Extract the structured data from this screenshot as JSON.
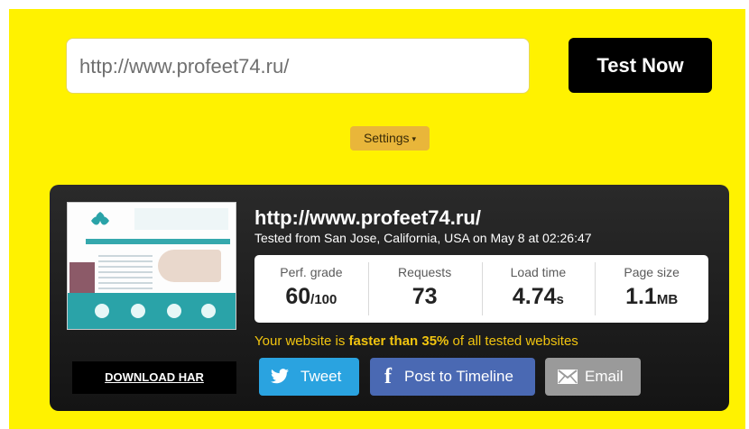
{
  "search": {
    "value": "http://www.profeet74.ru/",
    "button_label": "Test Now"
  },
  "settings": {
    "label": "Settings",
    "caret": "▾"
  },
  "result": {
    "url": "http://www.profeet74.ru/",
    "tested_from": "Tested from San Jose, California, USA on May 8 at 02:26:47",
    "metrics": [
      {
        "label": "Perf. grade",
        "value": "60",
        "unit": "/100"
      },
      {
        "label": "Requests",
        "value": "73",
        "unit": ""
      },
      {
        "label": "Load time",
        "value": "4.74",
        "unit": "s"
      },
      {
        "label": "Page size",
        "value": "1.1",
        "unit": "MB"
      }
    ],
    "comparison": {
      "prefix": "Your website is ",
      "highlight": "faster than 35%",
      "suffix": " of all tested websites"
    }
  },
  "actions": {
    "download_har": "DOWNLOAD HAR",
    "tweet": "Tweet",
    "facebook": "Post to Timeline",
    "facebook_icon": "f",
    "email": "Email"
  },
  "icons": {
    "twitter": "twitter-bird-icon",
    "facebook": "facebook-icon",
    "email": "envelope-icon"
  },
  "colors": {
    "background": "#fff200",
    "panel": "#1c1c1c",
    "settings_button": "#e9b63a",
    "comparison_text": "#f1c40f",
    "tweet": "#2aa3e0",
    "facebook": "#4a69b3",
    "email": "#9a9a9a"
  }
}
